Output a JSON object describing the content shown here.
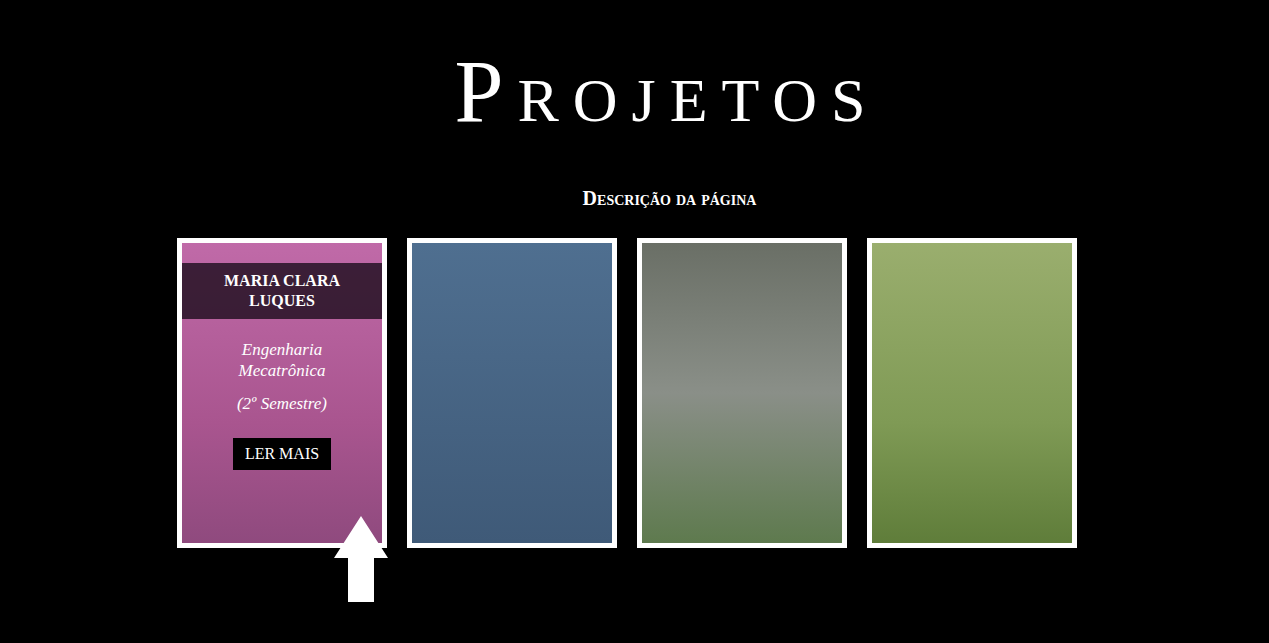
{
  "page": {
    "title": "Projetos",
    "description": "Descrição da página"
  },
  "cards": [
    {
      "kind": "profile",
      "name": "MARIA CLARA LUQUES",
      "course": "Engenharia Mecatrônica",
      "semester": "(2º Semestre)",
      "button": "LER MAIS"
    },
    {
      "kind": "photo"
    },
    {
      "kind": "photo"
    },
    {
      "kind": "photo"
    }
  ]
}
